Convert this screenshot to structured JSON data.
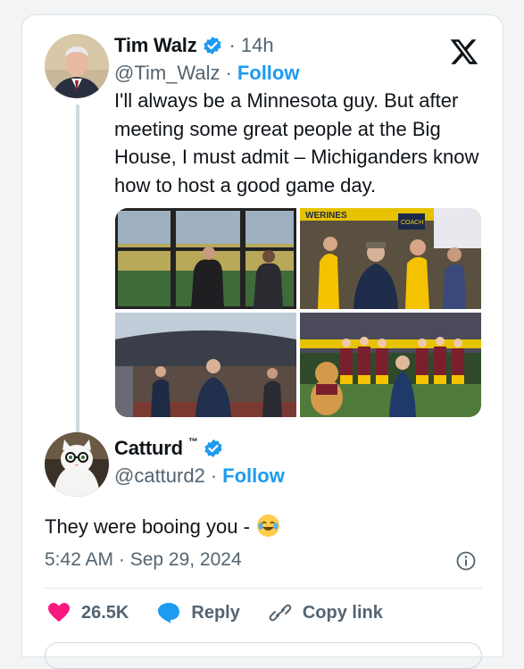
{
  "tweet": {
    "author_name": "Tim Walz",
    "time": "14h",
    "handle": "@Tim_Walz",
    "separator": "·",
    "follow_label": "Follow",
    "text": "I'll always be a Minnesota guy. But after meeting some great people at the Big House, I must admit – Michiganders know how to host a good game day.",
    "photo_signage": [
      "WERINES",
      "COACH"
    ]
  },
  "reply": {
    "author_name": "Catturd",
    "trademark": "™",
    "handle": "@catturd2",
    "separator": "·",
    "follow_label": "Follow",
    "text": "They were booing you -",
    "emoji": "face-with-tears-of-joy",
    "timestamp": "5:42 AM · Sep 29, 2024"
  },
  "actions": {
    "like_count": "26.5K",
    "reply_label": "Reply",
    "copy_link_label": "Copy link"
  },
  "colors": {
    "verified": "#1d9bf0",
    "follow": "#1d9bf0",
    "like": "#f91880",
    "reply_icon": "#1d9bf0",
    "text_secondary": "#536471"
  },
  "icons": [
    "verified-badge-icon",
    "x-logo-icon",
    "info-icon",
    "heart-icon",
    "reply-bubble-icon",
    "link-icon"
  ]
}
